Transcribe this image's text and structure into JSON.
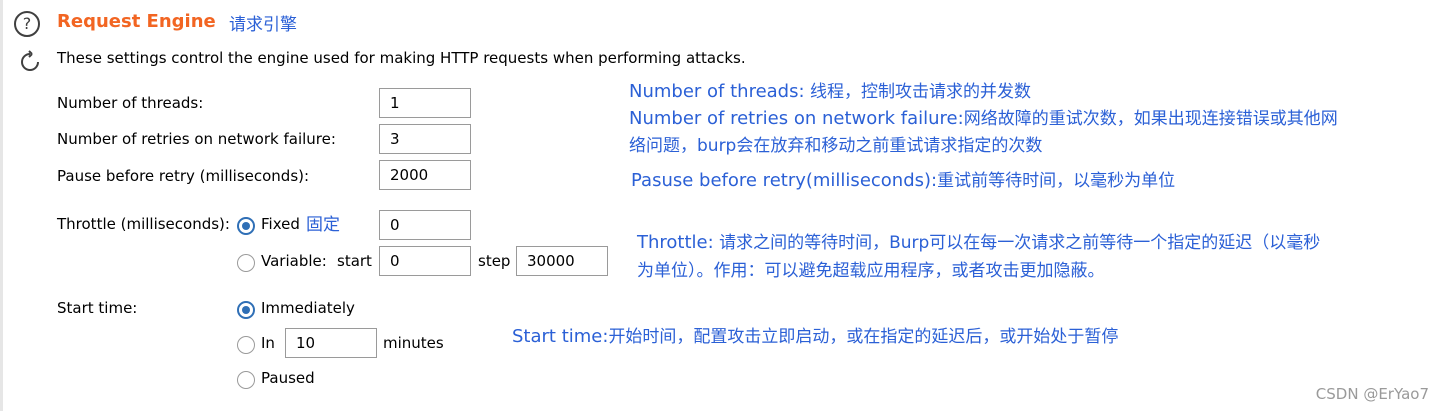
{
  "section": {
    "title": "Request Engine",
    "title_annotation": "请求引擎",
    "description": "These settings control the engine used for making HTTP requests when performing attacks."
  },
  "fields": {
    "threads": {
      "label": "Number of threads:",
      "value": "1"
    },
    "retries": {
      "label": "Number of retries on network failure:",
      "value": "3"
    },
    "pause": {
      "label": "Pause before retry (milliseconds):",
      "value": "2000"
    }
  },
  "throttle": {
    "label": "Throttle (milliseconds):",
    "fixed_label": "Fixed",
    "fixed_annotation": "固定",
    "fixed_value": "0",
    "fixed_selected": true,
    "variable_label": "Variable:",
    "start_label": "start",
    "start_value": "0",
    "step_label": "step",
    "step_value": "30000"
  },
  "start_time": {
    "label": "Start time:",
    "immediately_label": "Immediately",
    "immediately_selected": true,
    "in_label": "In",
    "in_value": "10",
    "minutes_label": "minutes",
    "paused_label": "Paused"
  },
  "annotations": {
    "threads": {
      "term": "Number of threads:",
      "text": " 线程，控制攻击请求的并发数"
    },
    "retries": {
      "term": "Number of retries on network failure:",
      "text": "网络故障的重试次数，如果出现连接错误或其他网",
      "line2": "络问题，burp会在放弃和移动之前重试请求指定的次数"
    },
    "pause": {
      "term": "Pasuse  before retry(milliseconds):",
      "text": "重试前等待时间，以毫秒为单位"
    },
    "throttle": {
      "term": "Throttle:",
      "text": " 请求之间的等待时间，Burp可以在每一次请求之前等待一个指定的延迟（以毫秒",
      "line2": "为单位）。作用：可以避免超载应用程序，或者攻击更加隐蔽。"
    },
    "start_time": {
      "term": "Start time:",
      "text": "开始时间，配置攻击立即启动，或在指定的延迟后，或开始处于暂停"
    }
  },
  "watermark": "CSDN @ErYao7",
  "icons": {
    "help": "help-icon",
    "refresh": "refresh-icon"
  },
  "colors": {
    "title": "#f26522",
    "annotation": "#2b60d6",
    "radio_selected": "#2f6fb6"
  }
}
